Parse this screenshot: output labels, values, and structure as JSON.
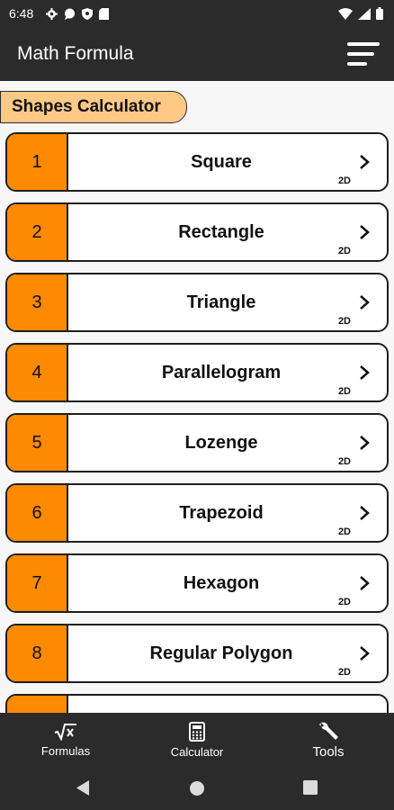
{
  "status_bar": {
    "time": "6:48",
    "icons": [
      "gear-icon",
      "chat-icon",
      "shield-icon",
      "sim-card-icon",
      "wifi-icon",
      "signal-icon",
      "battery-icon"
    ]
  },
  "app_bar": {
    "title": "Math Formula",
    "menu_icon": "sort-menu-icon"
  },
  "section": {
    "title": "Shapes Calculator"
  },
  "colors": {
    "bar_background": "#2b2b2b",
    "accent_orange": "#fd8a00",
    "chip_background": "#fcc987",
    "page_background": "#f7f7f7"
  },
  "items": [
    {
      "number": "1",
      "label": "Square",
      "tag": "2D"
    },
    {
      "number": "2",
      "label": "Rectangle",
      "tag": "2D"
    },
    {
      "number": "3",
      "label": "Triangle",
      "tag": "2D"
    },
    {
      "number": "4",
      "label": "Parallelogram",
      "tag": "2D"
    },
    {
      "number": "5",
      "label": "Lozenge",
      "tag": "2D"
    },
    {
      "number": "6",
      "label": "Trapezoid",
      "tag": "2D"
    },
    {
      "number": "7",
      "label": "Hexagon",
      "tag": "2D"
    },
    {
      "number": "8",
      "label": "Regular Polygon",
      "tag": "2D"
    },
    {
      "number": "",
      "label": "",
      "tag": ""
    }
  ],
  "bottom_nav": {
    "items": [
      {
        "label": "Formulas",
        "icon": "square-root-icon"
      },
      {
        "label": "Calculator",
        "icon": "calculator-icon"
      },
      {
        "label": "Tools",
        "icon": "wrench-icon"
      }
    ]
  }
}
